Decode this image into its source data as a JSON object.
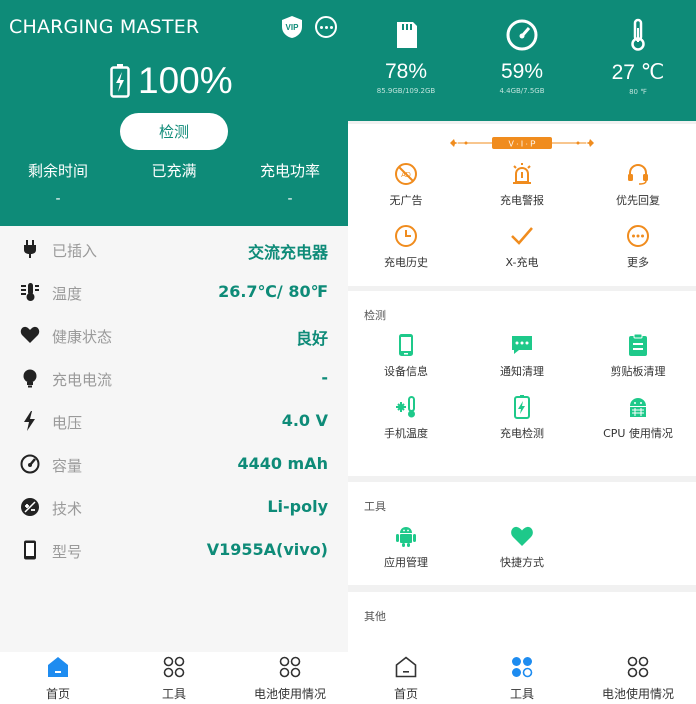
{
  "left": {
    "app_title": "CHARGING MASTER",
    "vip_text": "VIP",
    "battery_percent": "100%",
    "detect_button": "检测",
    "stats": [
      {
        "label": "剩余时间",
        "value": "-"
      },
      {
        "label": "已充满",
        "value": ""
      },
      {
        "label": "充电功率",
        "value": "-"
      }
    ],
    "info": [
      {
        "icon": "plug-icon",
        "label": "已插入",
        "value": "交流充电器"
      },
      {
        "icon": "thermometer-icon",
        "label": "温度",
        "value": "26.7℃/ 80℉"
      },
      {
        "icon": "heart-icon",
        "label": "健康状态",
        "value": "良好"
      },
      {
        "icon": "bulb-icon",
        "label": "充电电流",
        "value": "-"
      },
      {
        "icon": "bolt-icon",
        "label": "电压",
        "value": "4.0 V"
      },
      {
        "icon": "gauge-icon",
        "label": "容量",
        "value": "4440 mAh"
      },
      {
        "icon": "tech-icon",
        "label": "技术",
        "value": "Li-poly"
      },
      {
        "icon": "phone-icon",
        "label": "型号",
        "value": "V1955A(vivo)"
      }
    ],
    "nav": [
      {
        "label": "首页",
        "active": true
      },
      {
        "label": "工具",
        "active": false
      },
      {
        "label": "电池使用情况",
        "active": false
      }
    ]
  },
  "right": {
    "stats": [
      {
        "icon": "sd-card-icon",
        "value": "78%",
        "sub": "85.9GB/109.2GB"
      },
      {
        "icon": "speedometer-icon",
        "value": "59%",
        "sub": "4.4GB/7.5GB"
      },
      {
        "icon": "thermometer-icon",
        "value": "27 ℃",
        "sub": "80 ℉"
      }
    ],
    "vip_ribbon": "V · I · P",
    "vip_items": [
      {
        "icon": "no-ads-icon",
        "label": "无广告"
      },
      {
        "icon": "alarm-icon",
        "label": "充电警报"
      },
      {
        "icon": "headset-icon",
        "label": "优先回复"
      },
      {
        "icon": "clock-icon",
        "label": "充电历史"
      },
      {
        "icon": "check-icon",
        "label": "X-充电"
      },
      {
        "icon": "more-icon",
        "label": "更多"
      }
    ],
    "detect_title": "检测",
    "detect_items": [
      {
        "icon": "phone-icon",
        "label": "设备信息"
      },
      {
        "icon": "message-icon",
        "label": "通知清理"
      },
      {
        "icon": "clipboard-icon",
        "label": "剪贴板清理"
      },
      {
        "icon": "snow-thermo-icon",
        "label": "手机温度"
      },
      {
        "icon": "battery-charge-icon",
        "label": "充电检测"
      },
      {
        "icon": "android-cpu-icon",
        "label": "CPU 使用情况"
      }
    ],
    "tools_title": "工具",
    "tools_items": [
      {
        "icon": "android-icon",
        "label": "应用管理"
      },
      {
        "icon": "heart-icon",
        "label": "快捷方式"
      }
    ],
    "other_title": "其他",
    "nav": [
      {
        "label": "首页",
        "active": false
      },
      {
        "label": "工具",
        "active": true
      },
      {
        "label": "电池使用情况",
        "active": false
      }
    ]
  },
  "colors": {
    "primary": "#0e8b78",
    "accent": "#f08c1e",
    "active_nav": "#1e8cf0",
    "grid_green": "#1ec98a"
  }
}
